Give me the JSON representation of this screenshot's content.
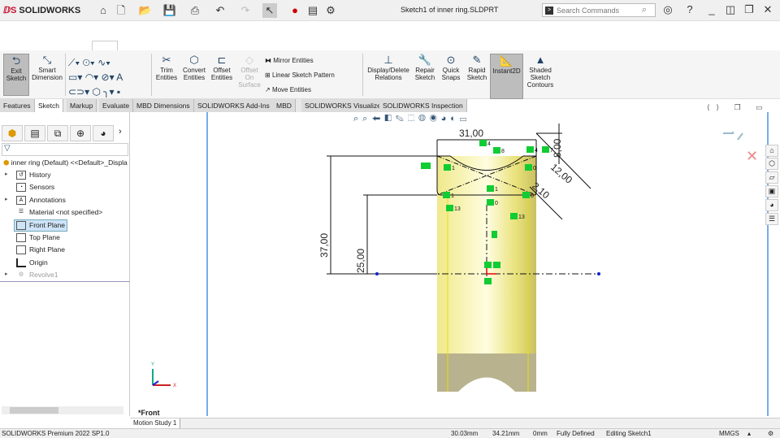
{
  "app": {
    "logo": "SOLIDWORKS",
    "title": "Sketch1 of inner ring.SLDPRT",
    "search_placeholder": "Search Commands"
  },
  "ribbon": {
    "exit_sketch": "Exit Sketch",
    "smart_dimension": "Smart Dimension",
    "trim": "Trim Entities",
    "convert": "Convert Entities",
    "offset": "Offset Entities",
    "offset_surface": "Offset On Surface",
    "mirror": "Mirror Entities",
    "linear_pattern": "Linear Sketch Pattern",
    "move": "Move Entities",
    "display_relations": "Display/Delete Relations",
    "repair": "Repair Sketch",
    "quick_snaps": "Quick Snaps",
    "rapid_sketch": "Rapid Sketch",
    "instant2d": "Instant2D",
    "shaded": "Shaded Sketch Contours"
  },
  "tabs": [
    "Features",
    "Sketch",
    "Markup",
    "Evaluate",
    "MBD Dimensions",
    "SOLIDWORKS Add-Ins",
    "MBD",
    "SOLIDWORKS Visualize",
    "SOLIDWORKS Inspection"
  ],
  "tree": {
    "root": "inner ring (Default) <<Default>_Displa",
    "items": [
      "History",
      "Sensors",
      "Annotations",
      "Material <not specified>",
      "Front Plane",
      "Top Plane",
      "Right Plane",
      "Origin",
      "Revolve1"
    ]
  },
  "view": {
    "orientation": "*Front",
    "dims": {
      "d31": "31,00",
      "d8": "8,00",
      "d12": "12,00",
      "d2_1": "2,10",
      "d37": "37,00",
      "d25": "25,00"
    },
    "relations": [
      "4",
      "8",
      "4",
      "7",
      "1",
      "0",
      "1",
      "0",
      "13",
      "13",
      "1",
      "0"
    ]
  },
  "motion_tab": "Motion Study 1",
  "status": {
    "product": "SOLIDWORKS Premium 2022 SP1.0",
    "x": "30.03mm",
    "y": "34.21mm",
    "z": "0mm",
    "state": "Fully Defined",
    "mode": "Editing Sketch1",
    "units": "MMGS"
  }
}
